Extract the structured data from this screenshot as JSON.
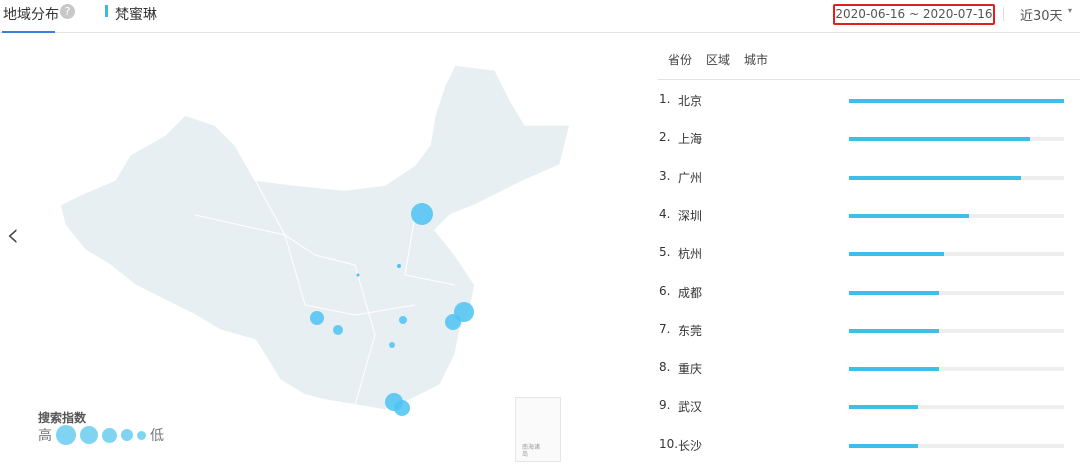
{
  "header": {
    "tab": "地域分布",
    "help": "?",
    "keyword": "梵蜜琳",
    "date_range": "2020-06-16 ~ 2020-07-16",
    "range_select": "近30天",
    "caret": "▾"
  },
  "nav": {
    "prev": "‹"
  },
  "legend": {
    "title": "搜索指数",
    "high": "高",
    "low": "低"
  },
  "inset": {
    "label": "南海诸岛"
  },
  "right_tabs": [
    "省份",
    "区域",
    "城市"
  ],
  "ranking": [
    {
      "rank": "1.",
      "city": "北京",
      "value": 1.0
    },
    {
      "rank": "2.",
      "city": "上海",
      "value": 0.84
    },
    {
      "rank": "3.",
      "city": "广州",
      "value": 0.8
    },
    {
      "rank": "4.",
      "city": "深圳",
      "value": 0.56
    },
    {
      "rank": "5.",
      "city": "杭州",
      "value": 0.44
    },
    {
      "rank": "6.",
      "city": "成都",
      "value": 0.42
    },
    {
      "rank": "7.",
      "city": "东莞",
      "value": 0.42
    },
    {
      "rank": "8.",
      "city": "重庆",
      "value": 0.42
    },
    {
      "rank": "9.",
      "city": "武汉",
      "value": 0.32
    },
    {
      "rank": "10.",
      "city": "长沙",
      "value": 0.32
    }
  ],
  "colors": {
    "accent": "#3dbfe8",
    "map": "#e8eff3",
    "bubble": "#4cc3f2",
    "highlight": "#e02020"
  }
}
